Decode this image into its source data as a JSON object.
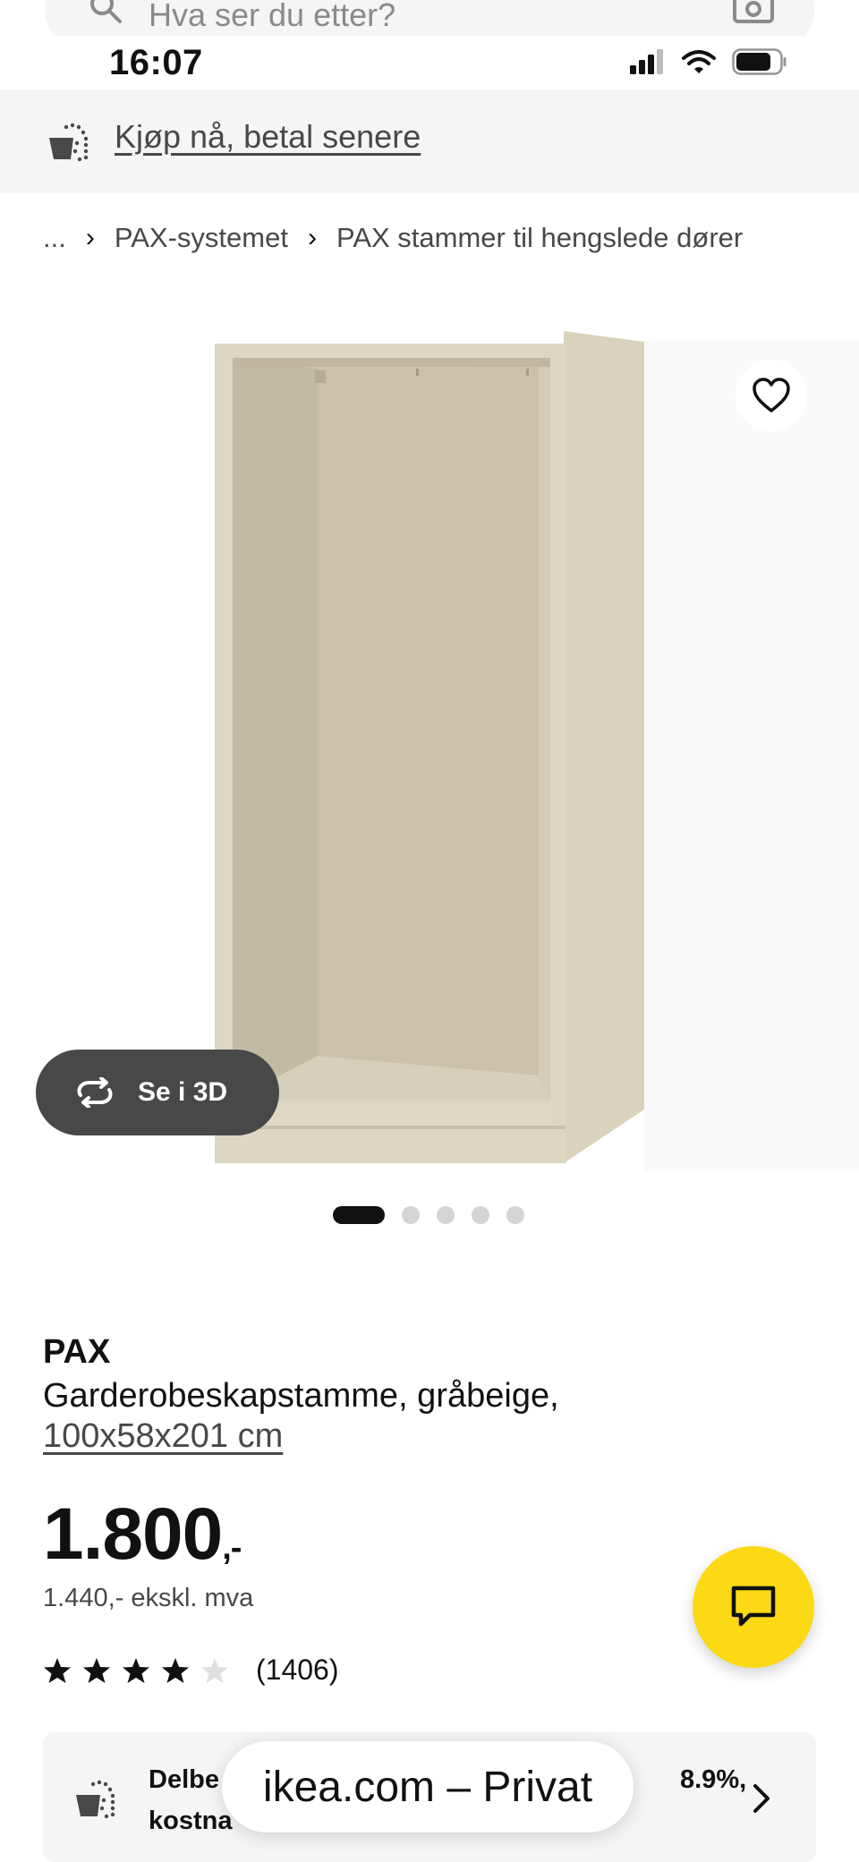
{
  "search": {
    "placeholder": "Hva ser du etter?"
  },
  "status_bar": {
    "time": "16:07"
  },
  "promo": {
    "link_text": "Kjøp nå, betal senere"
  },
  "breadcrumb": {
    "ellipsis": "...",
    "items": [
      "PAX-systemet",
      "PAX stammer til hengslede dører"
    ]
  },
  "media": {
    "view_3d_label": "Se i 3D",
    "slide_count": 5,
    "active_slide": 1
  },
  "product": {
    "name": "PAX",
    "description": "Garderobeskapstamme, gråbeige,",
    "size": "100x58x201 cm",
    "price_main": "1.800",
    "price_suffix": ",-",
    "price_ex_vat": "1.440,- ekskl. mva",
    "rating_stars": 4,
    "rating_max": 5,
    "rating_count": "(1406)"
  },
  "finance": {
    "text_line1": "Delbe",
    "text_line1_end": "8.9%,",
    "text_line2": "kostna"
  },
  "browser": {
    "url_label": "ikea.com – Privat"
  },
  "colors": {
    "accent_yellow": "#fbd914",
    "text_dark": "#111111",
    "text_muted": "#484848",
    "panel_bg": "#f5f5f5"
  }
}
